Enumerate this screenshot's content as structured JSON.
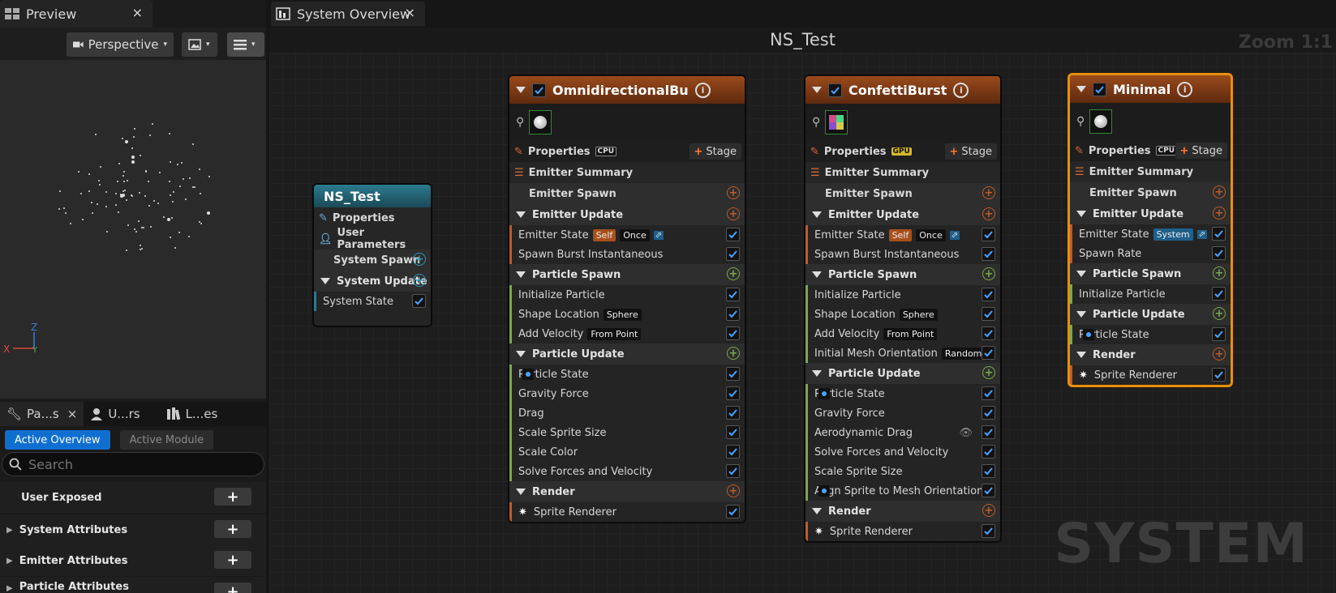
{
  "tabs": {
    "preview": "Preview",
    "graph": "System Overview",
    "close": "×"
  },
  "viewport": {
    "perspective": "Perspective"
  },
  "panel_tabs": [
    {
      "label": "Pa...s"
    },
    {
      "label": "U...rs"
    },
    {
      "label": "L...es"
    }
  ],
  "panel_buttons": {
    "active_overview": "Active Overview",
    "active_module": "Active Module"
  },
  "search": {
    "placeholder": "Search"
  },
  "attributes": [
    {
      "label": "User Exposed"
    },
    {
      "label": "System Attributes"
    },
    {
      "label": "Emitter Attributes"
    },
    {
      "label": "Particle Attributes"
    }
  ],
  "graph": {
    "title": "NS_Test",
    "zoom": "Zoom 1:1",
    "watermark": "SYSTEM"
  },
  "system_node": {
    "title": "NS_Test",
    "properties": "Properties",
    "user_parameters": "User Parameters",
    "system_spawn": "System Spawn",
    "system_update": "System Update",
    "system_state": "System State"
  },
  "labels": {
    "properties": "Properties",
    "stage": "Stage",
    "emitter_summary": "Emitter Summary",
    "emitter_spawn": "Emitter Spawn",
    "emitter_update": "Emitter Update",
    "particle_spawn": "Particle Spawn",
    "particle_update": "Particle Update",
    "render": "Render",
    "emitter_state": "Emitter State",
    "self": "Self",
    "once": "Once",
    "system": "System",
    "sprite_renderer": "Sprite Renderer",
    "cpu": "CPU",
    "gpu": "GPU"
  },
  "emitters": {
    "omni": {
      "title": "OmnidirectionalBurst",
      "spawn": [
        "Spawn Burst Instantaneous"
      ],
      "particle_spawn": [
        "Initialize Particle",
        "Shape Location",
        "Add Velocity"
      ],
      "particle_update": [
        "Particle State",
        "Gravity Force",
        "Drag",
        "Scale Sprite Size",
        "Scale Color",
        "Solve Forces and Velocity"
      ],
      "tags": {
        "shape": "Sphere",
        "velocity": "From Point"
      }
    },
    "confetti": {
      "title": "ConfettiBurst",
      "spawn": [
        "Spawn Burst Instantaneous"
      ],
      "particle_spawn": [
        "Initialize Particle",
        "Shape Location",
        "Add Velocity",
        "Initial Mesh Orientation"
      ],
      "particle_update": [
        "Particle State",
        "Gravity Force",
        "Aerodynamic Drag",
        "Solve Forces and Velocity",
        "Scale Sprite Size",
        "Align Sprite to Mesh Orientation"
      ],
      "tags": {
        "shape": "Sphere",
        "velocity": "From Point",
        "orientation": "Random"
      }
    },
    "minimal": {
      "title": "Minimal",
      "spawn": [
        "Spawn Rate"
      ],
      "particle_spawn": [
        "Initialize Particle"
      ],
      "particle_update": [
        "Particle State"
      ]
    }
  },
  "colors": {
    "emitter_header": "#9a4a1c",
    "system_header": "#2b7a8e",
    "selected": "#e8900a",
    "emitter_rail": "#c05a28",
    "spawn_rail": "#7ba84a",
    "accent_blue": "#0f6fd1"
  }
}
